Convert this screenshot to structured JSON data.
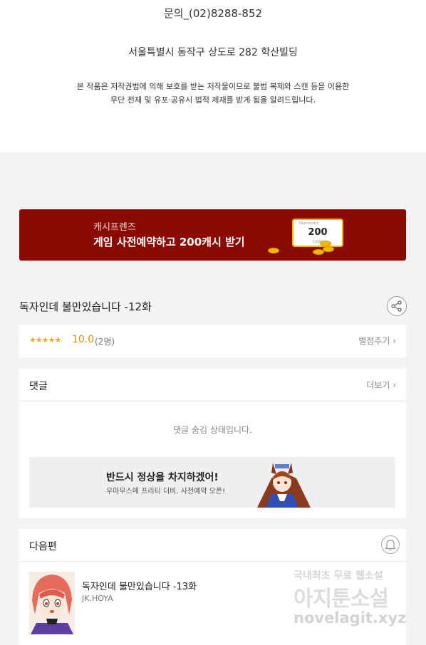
{
  "footer": {
    "contact": "문의_(02)8288-852",
    "address": "서울특별시 동작구 상도로 282 학산빌딩",
    "notice_line1": "본 작품은 저작권법에 의해 보호를 받는 저작물이므로 불법 복제와 스캔 등을 이용한",
    "notice_line2": "무단 전재 및 유포·공유시 법적 제재를 받게 됨을 알려드립니다."
  },
  "banner": {
    "small": "캐시프렌즈",
    "big": "게임 사전예약하고 200캐시 받기",
    "ticket_amount": "200",
    "ticket_top": "Fashiondsn",
    "ticket_bottom": "CASH",
    "bg_color": "#8b0a00"
  },
  "episode": {
    "title": "독자인데 불만있습니다  -12화",
    "share_icon": "share-icon"
  },
  "rating": {
    "stars": "★★★★★",
    "score": "10.0",
    "count": "(2명)",
    "rate_link": "별점주기 ›"
  },
  "comments": {
    "header": "댓글",
    "more": "더보기 ›",
    "hidden_msg": "댓글 숨김 상태입니다.",
    "ad_title": "반드시 정상을 차지하겠어!",
    "ad_sub": "우마무스메 프리티 더비, 사전예약 오픈!"
  },
  "next": {
    "header": "다음편",
    "title": "독자인데 불만있습니다  -13화",
    "author": "JK,HOYA"
  },
  "watermark": {
    "line1": "국내최초 무료 웹소설",
    "line2": "아지툰소설",
    "line3": "novelagit.xyz"
  }
}
